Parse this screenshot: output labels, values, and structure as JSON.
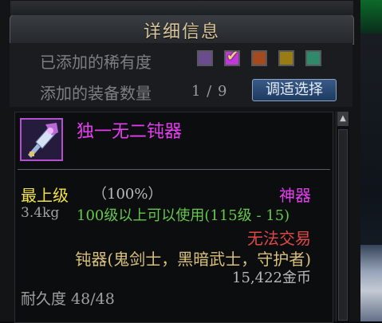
{
  "window": {
    "title": "详细信息"
  },
  "rarity_filter": {
    "label": "已添加的稀有度",
    "swatches": [
      {
        "color": "#6b4c8e",
        "checked": false
      },
      {
        "color": "#c038d8",
        "checked": true
      },
      {
        "color": "#a34b1e",
        "checked": false
      },
      {
        "color": "#9a7d12",
        "checked": false
      },
      {
        "color": "#2f8a6a",
        "checked": false
      }
    ]
  },
  "equip_count": {
    "label": "添加的装备数量",
    "value": "1 / 9",
    "button_label": "调适选择"
  },
  "item": {
    "name": "独一无二钝器",
    "icon": "blunt-weapon-icon",
    "grade_label": "最上级",
    "grade_percent": "（100%）",
    "rarity": "神器",
    "weight": "3.4kg",
    "level_requirement": "100级以上可以使用(115级 - 15)",
    "trade_status": "无法交易",
    "classes": "钝器(鬼剑士，黑暗武士，守护者)",
    "price": "15,422金币",
    "durability_label": "耐久度 48/48"
  },
  "colors": {
    "rarity_artifact": "#e63cf2",
    "grade_gold": "#f2e24a",
    "requirement_green": "#63c84b",
    "untradable_red": "#e04848"
  }
}
